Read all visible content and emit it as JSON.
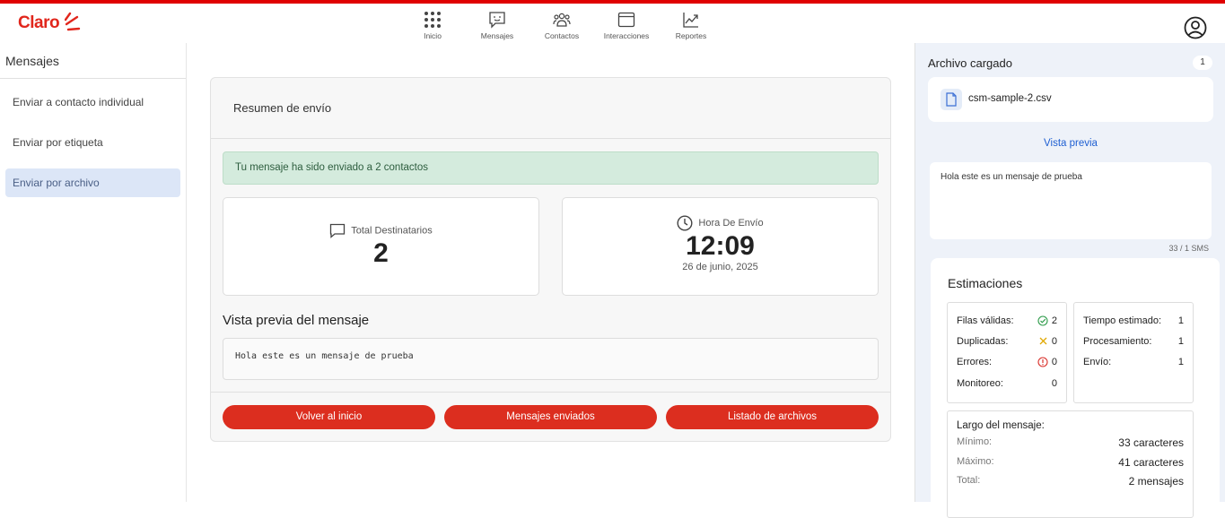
{
  "brand": {
    "logo_text": "Claro"
  },
  "nav": [
    {
      "label": "Inicio",
      "icon": "grid-icon"
    },
    {
      "label": "Mensajes",
      "icon": "chat-icon"
    },
    {
      "label": "Contactos",
      "icon": "people-icon"
    },
    {
      "label": "Interacciones",
      "icon": "window-icon"
    },
    {
      "label": "Reportes",
      "icon": "chart-icon"
    }
  ],
  "sidebar": {
    "title": "Mensajes",
    "items": [
      {
        "label": "Enviar a contacto individual",
        "active": false
      },
      {
        "label": "Enviar por etiqueta",
        "active": false
      },
      {
        "label": "Enviar por archivo",
        "active": true
      }
    ]
  },
  "summary": {
    "title": "Resumen de envío",
    "success_message": "Tu mensaje ha sido enviado a 2 contactos",
    "recipients_label": "Total Destinatarios",
    "recipients_value": "2",
    "time_label": "Hora De Envío",
    "time_value": "12:09",
    "date_value": "26 de junio, 2025",
    "preview_title": "Vista previa del mensaje",
    "preview_text": "Hola este es un mensaje de prueba",
    "buttons": {
      "home": "Volver al inicio",
      "sent": "Mensajes enviados",
      "files": "Listado de archivos"
    }
  },
  "right_panel": {
    "title": "Archivo cargado",
    "badge": "1",
    "file_name": "csm-sample-2.csv",
    "preview_link": "Vista previa",
    "message": "Hola este es un mensaje de prueba",
    "sms_count": "33 / 1 SMS",
    "estimations": {
      "title": "Estimaciones",
      "left": [
        {
          "label": "Filas válidas:",
          "value": "2",
          "icon": "check-circle-icon"
        },
        {
          "label": "Duplicadas:",
          "value": "0",
          "icon": "x-icon"
        },
        {
          "label": "Errores:",
          "value": "0",
          "icon": "alert-circle-icon"
        },
        {
          "label": "Monitoreo:",
          "value": "0",
          "icon": ""
        }
      ],
      "right": [
        {
          "label": "Tiempo estimado:",
          "value": "1"
        },
        {
          "label": "Procesamiento:",
          "value": "1"
        },
        {
          "label": "Envío:",
          "value": "1"
        }
      ],
      "length_title": "Largo del mensaje:",
      "length": [
        {
          "label": "Mínimo:",
          "value": "33 caracteres"
        },
        {
          "label": "Máximo:",
          "value": "41 caracteres"
        },
        {
          "label": "Total:",
          "value": "2 mensajes"
        }
      ]
    }
  },
  "colors": {
    "brand_red": "#e1261c",
    "button_red": "#dc2e1f",
    "success_bg": "#d4ebdd",
    "link_blue": "#1e5fd2"
  }
}
